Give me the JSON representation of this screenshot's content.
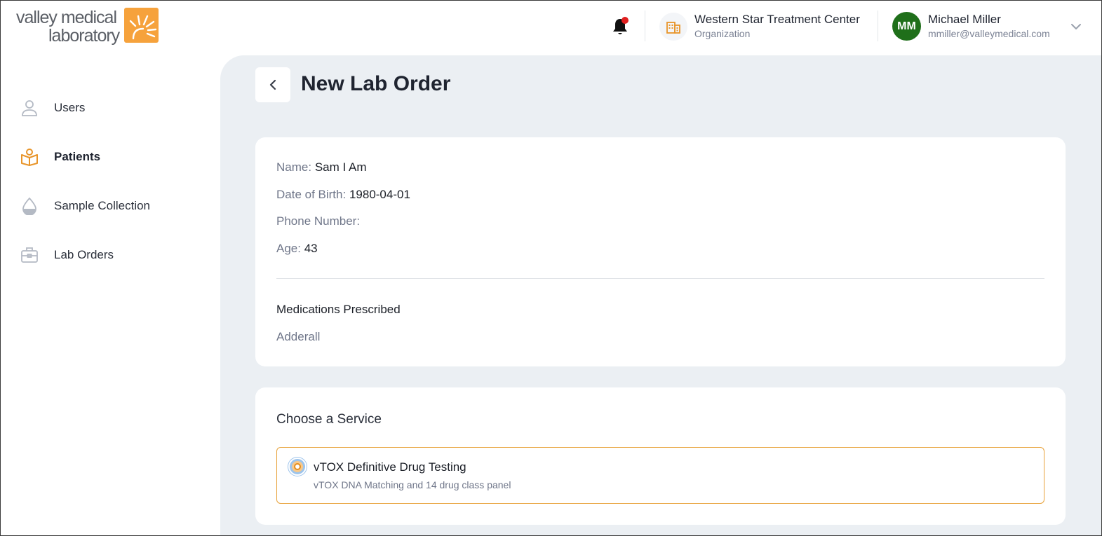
{
  "brand": {
    "logo_line1": "valley medical",
    "logo_line2": "laboratory",
    "accent_color": "#f6a23c"
  },
  "header": {
    "notification_icon": "bell-icon",
    "notification_badge_color": "#e02020",
    "organization": {
      "icon": "building-icon",
      "name": "Western Star Treatment Center",
      "role": "Organization"
    },
    "user": {
      "initials": "MM",
      "name": "Michael Miller",
      "email": "mmiller@valleymedical.com",
      "avatar_color": "#1f6f1a",
      "menu_icon": "chevron-down-icon"
    }
  },
  "sidebar": {
    "items": [
      {
        "label": "Users",
        "icon": "user-icon",
        "active": false
      },
      {
        "label": "Patients",
        "icon": "patient-icon",
        "active": true
      },
      {
        "label": "Sample Collection",
        "icon": "droplet-icon",
        "active": false
      },
      {
        "label": "Lab Orders",
        "icon": "briefcase-icon",
        "active": false
      }
    ]
  },
  "main": {
    "back_icon": "chevron-left-icon",
    "title": "New Lab Order",
    "patient": {
      "name_label": "Name:",
      "name_value": "Sam I Am",
      "dob_label": "Date of Birth:",
      "dob_value": "1980-04-01",
      "phone_label": "Phone Number:",
      "phone_value": "",
      "age_label": "Age:",
      "age_value": "43",
      "medications_heading": "Medications Prescribed",
      "medications": [
        "Adderall"
      ]
    },
    "service": {
      "heading": "Choose a Service",
      "options": [
        {
          "title": "vTOX Definitive Drug Testing",
          "description": "vTOX DNA Matching and 14 drug class panel",
          "selected": true
        }
      ]
    }
  }
}
